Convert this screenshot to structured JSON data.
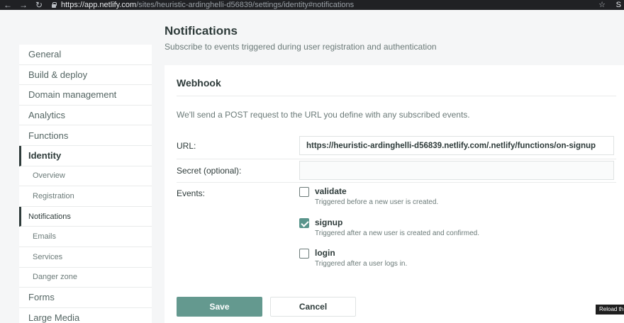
{
  "browser": {
    "back_icon": "←",
    "forward_icon": "→",
    "reload_icon": "↻",
    "url_host": "https://app.netlify.com",
    "url_path": "/sites/heuristic-ardinghelli-d56839/settings/identity#notifications",
    "star_icon": "☆",
    "profile_initial": "S"
  },
  "sidebar": {
    "items": [
      {
        "label": "General"
      },
      {
        "label": "Build & deploy"
      },
      {
        "label": "Domain management"
      },
      {
        "label": "Analytics"
      },
      {
        "label": "Functions"
      },
      {
        "label": "Identity"
      },
      {
        "label": "Overview"
      },
      {
        "label": "Registration"
      },
      {
        "label": "Notifications"
      },
      {
        "label": "Emails"
      },
      {
        "label": "Services"
      },
      {
        "label": "Danger zone"
      },
      {
        "label": "Forms"
      },
      {
        "label": "Large Media"
      }
    ]
  },
  "header": {
    "title": "Notifications",
    "subtitle": "Subscribe to events triggered during user registration and authentication"
  },
  "webhook": {
    "title": "Webhook",
    "description": "We'll send a POST request to the URL you define with any subscribed events.",
    "url_label": "URL:",
    "url_value": "https://heuristic-ardinghelli-d56839.netlify.com/.netlify/functions/on-signup",
    "secret_label": "Secret (optional):",
    "secret_value": "",
    "events_label": "Events:",
    "events": [
      {
        "name": "validate",
        "description": "Triggered before a new user is created.",
        "checked": false
      },
      {
        "name": "signup",
        "description": "Triggered after a new user is created and confirmed.",
        "checked": true
      },
      {
        "name": "login",
        "description": "Triggered after a user logs in.",
        "checked": false
      }
    ],
    "save_label": "Save",
    "cancel_label": "Cancel"
  },
  "tooltip": {
    "text": "Reload th"
  },
  "colors": {
    "accent": "#5a958c",
    "save_button": "#64998f",
    "text": "#2e3b3a",
    "muted": "#6b7a78",
    "background": "#f5f6f7"
  }
}
